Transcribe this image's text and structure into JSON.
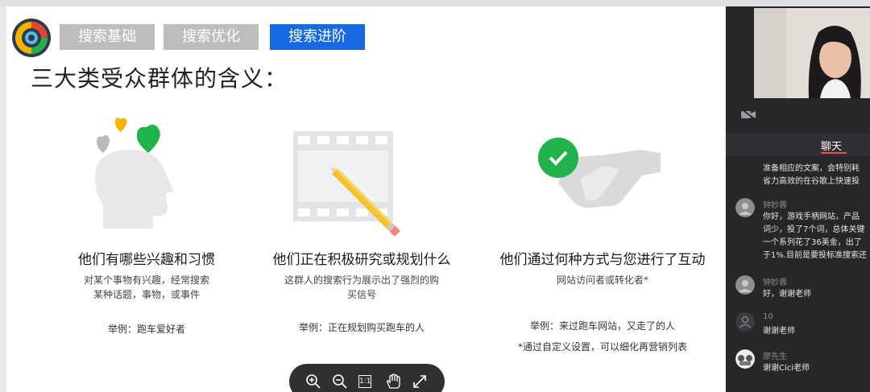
{
  "tabs": [
    {
      "label": "搜索基础",
      "active": false
    },
    {
      "label": "搜索优化",
      "active": false
    },
    {
      "label": "搜索进阶",
      "active": true
    }
  ],
  "title": "三大类受众群体的含义：",
  "columns": [
    {
      "heading": "他们有哪些兴趣和习惯",
      "desc": [
        "对某个事物有兴趣，经常搜索",
        "某种话题，事物，或事件"
      ],
      "example": "举例：跑车爱好者"
    },
    {
      "heading": "他们正在积极研究或规划什么",
      "desc": [
        "这群人的搜索行为展示出了强烈的购",
        "买信号"
      ],
      "example": "举例：正在规划购买跑车的人"
    },
    {
      "heading": "他们通过何种方式与您进行了互动",
      "desc": [
        "网站访问者或转化者*"
      ],
      "example": "举例：来过跑车网站，又走了的人"
    }
  ],
  "note": "*通过自定义设置，可以细化再营销列表",
  "zoom_controls": {
    "fit_label": "1:1"
  },
  "chat": {
    "tab_label": "聊天",
    "messages": [
      {
        "name": "",
        "lines": [
          "准备相应的文案，会特别耗",
          "省力高效的在谷歌上快速投"
        ]
      },
      {
        "name": "钟妙蓉",
        "lines": [
          "你好，游戏手柄网站，产品",
          "词少，投了7个词，总体关键",
          "一个系列花了36美金，出了",
          "于1%.目前是要投标准搜索还"
        ]
      },
      {
        "name": "钟妙蓉",
        "lines": [
          "好，谢谢老师"
        ]
      },
      {
        "name": "10",
        "lines": [
          "谢谢老师"
        ]
      },
      {
        "name": "廖先生",
        "lines": [
          "谢谢Cici老师"
        ]
      }
    ]
  },
  "colors": {
    "accent": "#1769e3",
    "tab_gray": "#bcbdbf",
    "heart_green": "#1fb34a",
    "heart_yellow": "#f6b400",
    "check_green": "#21b24b"
  }
}
